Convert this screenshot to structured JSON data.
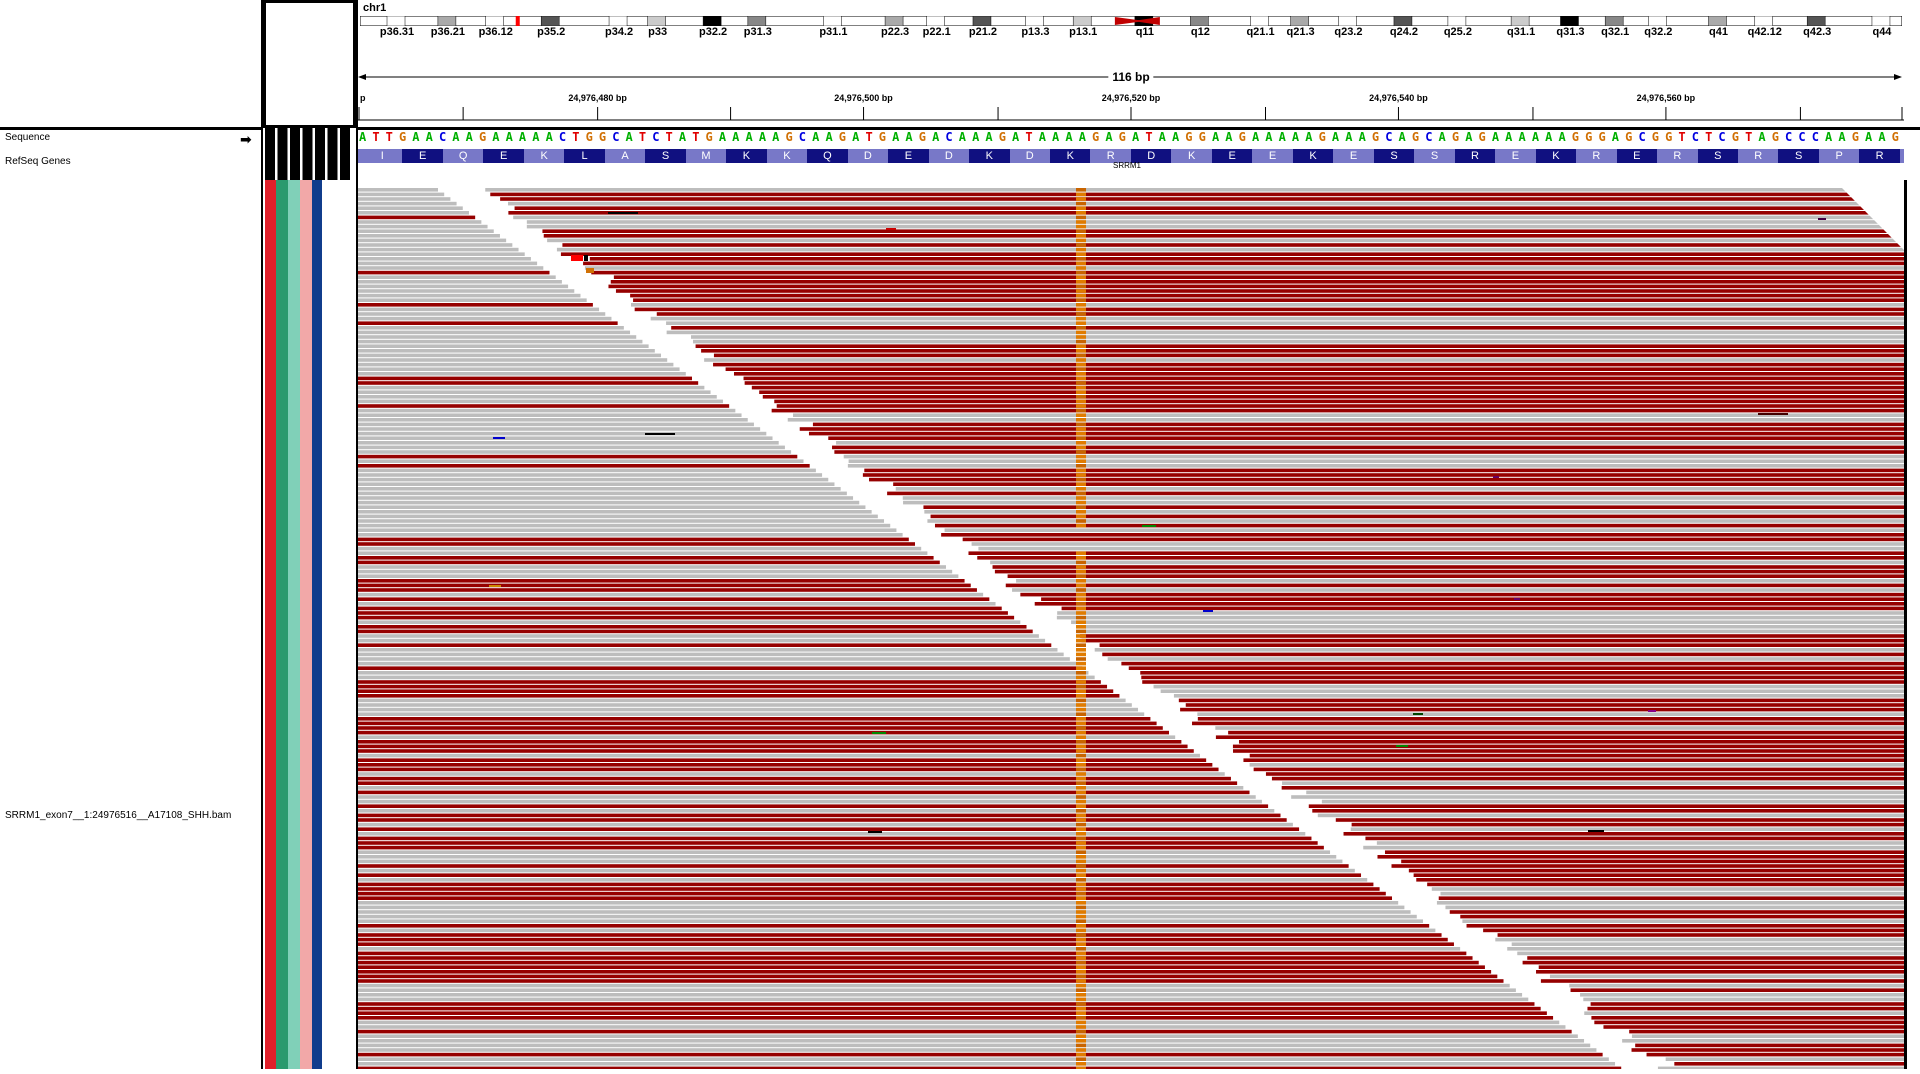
{
  "header": {
    "chromosome": "chr1",
    "span_label": "116 bp",
    "left_edge_label": "p"
  },
  "ideogram_bands": [
    {
      "label": "p36.31",
      "pos": 0.024
    },
    {
      "label": "p36.21",
      "pos": 0.057
    },
    {
      "label": "p36.12",
      "pos": 0.088
    },
    {
      "label": "p35.2",
      "pos": 0.124
    },
    {
      "label": "p34.2",
      "pos": 0.168
    },
    {
      "label": "p33",
      "pos": 0.193
    },
    {
      "label": "p32.2",
      "pos": 0.229
    },
    {
      "label": "p31.3",
      "pos": 0.258
    },
    {
      "label": "p31.1",
      "pos": 0.307
    },
    {
      "label": "p22.3",
      "pos": 0.347
    },
    {
      "label": "p22.1",
      "pos": 0.374
    },
    {
      "label": "p21.2",
      "pos": 0.404
    },
    {
      "label": "p13.3",
      "pos": 0.438
    },
    {
      "label": "p13.1",
      "pos": 0.469
    },
    {
      "label": "q11",
      "pos": 0.509
    },
    {
      "label": "q12",
      "pos": 0.545
    },
    {
      "label": "q21.1",
      "pos": 0.584
    },
    {
      "label": "q21.3",
      "pos": 0.61
    },
    {
      "label": "q23.2",
      "pos": 0.641
    },
    {
      "label": "q24.2",
      "pos": 0.677
    },
    {
      "label": "q25.2",
      "pos": 0.712
    },
    {
      "label": "q31.1",
      "pos": 0.753
    },
    {
      "label": "q31.3",
      "pos": 0.785
    },
    {
      "label": "q32.1",
      "pos": 0.814
    },
    {
      "label": "q32.2",
      "pos": 0.842
    },
    {
      "label": "q41",
      "pos": 0.881
    },
    {
      "label": "q42.12",
      "pos": 0.911
    },
    {
      "label": "q42.3",
      "pos": 0.945
    },
    {
      "label": "q44",
      "pos": 0.987
    }
  ],
  "ruler_ticks": [
    {
      "label": "24,976,480 bp",
      "pos": 0.155
    },
    {
      "label": "24,976,500 bp",
      "pos": 0.327
    },
    {
      "label": "24,976,520 bp",
      "pos": 0.5
    },
    {
      "label": "24,976,540 bp",
      "pos": 0.673
    },
    {
      "label": "24,976,560 bp",
      "pos": 0.846
    }
  ],
  "tracks": {
    "sequence_label": "Sequence",
    "refseq_label": "RefSeq Genes",
    "bam_label": "SRRM1_exon7__1:24976516__A17108_SHH.bam",
    "gene_name": "SRRM1"
  },
  "sequence": "ATTGAACAAGAAAAACTGGCATCTATGAAAAAGCAAGATGAAGACAAAGATAAAAGAGATAAGGAAGAAAAAGAAAGCAGCAGAGAAAAAAGGGAGCGGTCTCGTAGCCCAAGAAG",
  "amino_acids": [
    "I",
    "E",
    "Q",
    "E",
    "K",
    "L",
    "A",
    "S",
    "M",
    "K",
    "K",
    "Q",
    "D",
    "E",
    "D",
    "K",
    "D",
    "K",
    "R",
    "D",
    "K",
    "E",
    "E",
    "K",
    "E",
    "S",
    "S",
    "R",
    "E",
    "K",
    "R",
    "E",
    "R",
    "S",
    "R",
    "S",
    "P",
    "R"
  ],
  "colors": {
    "A": "#00b000",
    "C": "#0000e0",
    "G": "#d17105",
    "T": "#e00000",
    "read_forward": "#960000",
    "read_gray": "#bdbdbd",
    "snp_column": "#e07b00",
    "aa_light": "#7878c8",
    "aa_dark": "#101080"
  },
  "attribute_colors": [
    "#e0202a",
    "#2a9a6e",
    "#80d0b8",
    "#f2a8a8",
    "#103c8c"
  ]
}
